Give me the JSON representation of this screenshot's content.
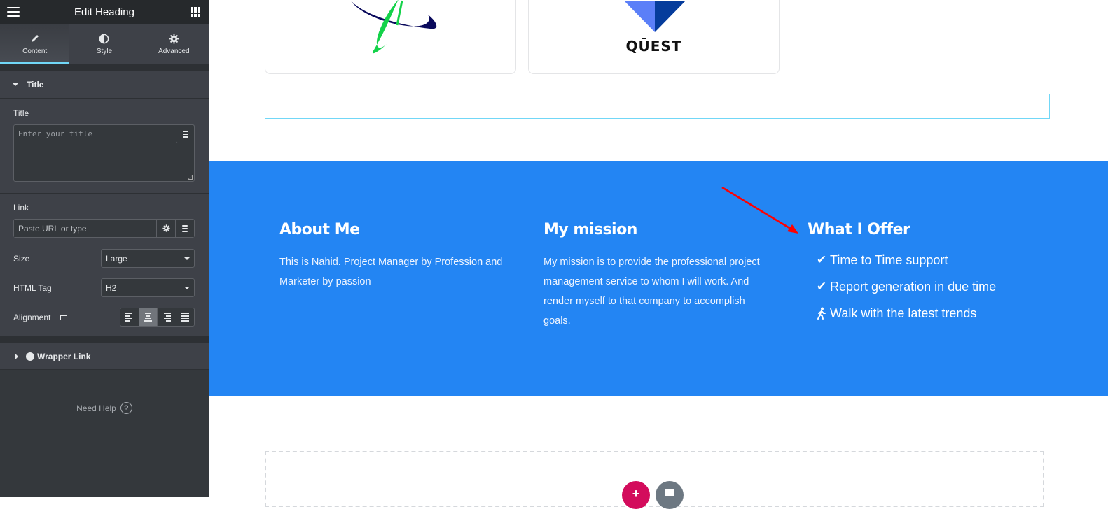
{
  "panel": {
    "title": "Edit Heading",
    "tabs": [
      {
        "label": "Content",
        "icon": "pencil-icon",
        "active": true
      },
      {
        "label": "Style",
        "icon": "half-circle-icon",
        "active": false
      },
      {
        "label": "Advanced",
        "icon": "gear-icon",
        "active": false
      }
    ],
    "section_title": "Title",
    "title_field": {
      "label": "Title",
      "placeholder": "Enter your title",
      "value": ""
    },
    "link_field": {
      "label": "Link",
      "placeholder": "Paste URL or type",
      "value": ""
    },
    "size": {
      "label": "Size",
      "value": "Large"
    },
    "html_tag": {
      "label": "HTML Tag",
      "value": "H2"
    },
    "alignment": {
      "label": "Alignment",
      "options": [
        "left",
        "center",
        "right",
        "justify"
      ],
      "selected": "center"
    },
    "wrapper_link": "Wrapper Link",
    "help": "Need Help",
    "help_glyph": "?",
    "collapse_glyph": "‹"
  },
  "canvas": {
    "logos": [
      {
        "name": "atom-orbit-logo",
        "colors": [
          "#0a0a5c",
          "#14d24a"
        ]
      },
      {
        "name": "quest-logo",
        "text": "QŪEST",
        "colors": [
          "#5b7ff8",
          "#053c9c"
        ]
      }
    ],
    "accent_color": "#2385f3",
    "selection_color": "#71d7f7",
    "columns": [
      {
        "heading": "About Me",
        "text": "This is Nahid. Project Manager by Profession and Marketer by passion"
      },
      {
        "heading": "My mission",
        "text": "My mission is to provide the professional project management service to whom I will work. And render myself to that company to accomplish goals."
      },
      {
        "heading": "What I Offer",
        "items": [
          {
            "icon": "check-icon",
            "glyph": "✔",
            "text": "Time to Time support"
          },
          {
            "icon": "check-icon",
            "glyph": "✔",
            "text": "Report generation in due time"
          },
          {
            "icon": "walking-icon",
            "glyph": "🚶",
            "text": "Walk with the latest trends"
          }
        ]
      }
    ],
    "add_section_glyph": "+",
    "annotation_arrow_color": "#ff0000"
  }
}
